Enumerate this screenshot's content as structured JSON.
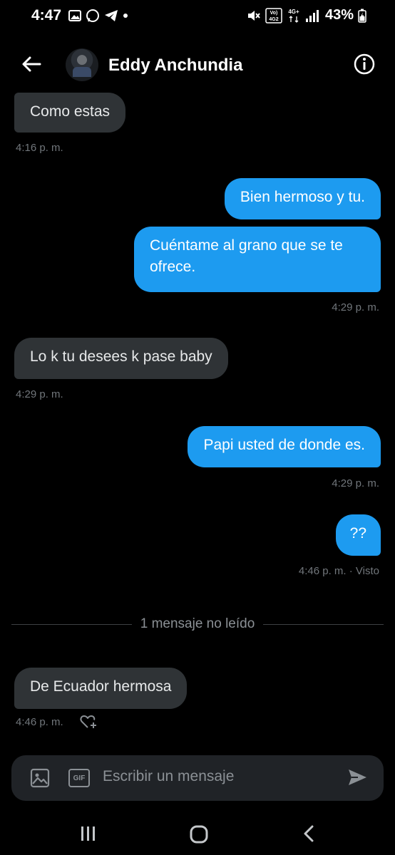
{
  "status_bar": {
    "time": "4:47",
    "network_top": "Vo)",
    "network_bottom": "4G2",
    "signal_label": "4G+",
    "battery": "43%"
  },
  "header": {
    "contact_name": "Eddy Anchundia",
    "avatar_icon": "avatar",
    "back_icon": "arrow-left-icon",
    "info_icon": "info-icon"
  },
  "conversation": {
    "messages": [
      {
        "direction": "in",
        "text": "Como estas",
        "time": "4:16 p. m."
      },
      {
        "direction": "out",
        "text": "Bien hermoso y tu."
      },
      {
        "direction": "out",
        "text": "Cuéntame al grano que se te ofrece.",
        "time": "4:29 p. m."
      },
      {
        "direction": "in",
        "text": "Lo k tu desees k pase baby",
        "time": "4:29 p. m."
      },
      {
        "direction": "out",
        "text": "Papi usted de donde es.",
        "time": "4:29 p. m."
      },
      {
        "direction": "out",
        "text": "??",
        "time": "4:46 p. m. · Visto"
      },
      {
        "direction": "in",
        "text": "De Ecuador hermosa",
        "time": "4:46 p. m."
      }
    ],
    "unread_divider": "1 mensaje no leído"
  },
  "composer": {
    "placeholder": "Escribir un mensaje",
    "gif_label": "GIF",
    "image_icon": "image-icon",
    "send_icon": "send-icon"
  },
  "colors": {
    "outgoing_bubble": "#1d9bf0",
    "incoming_bubble": "#2f3336",
    "background": "#000000",
    "timestamp": "#71767b"
  }
}
